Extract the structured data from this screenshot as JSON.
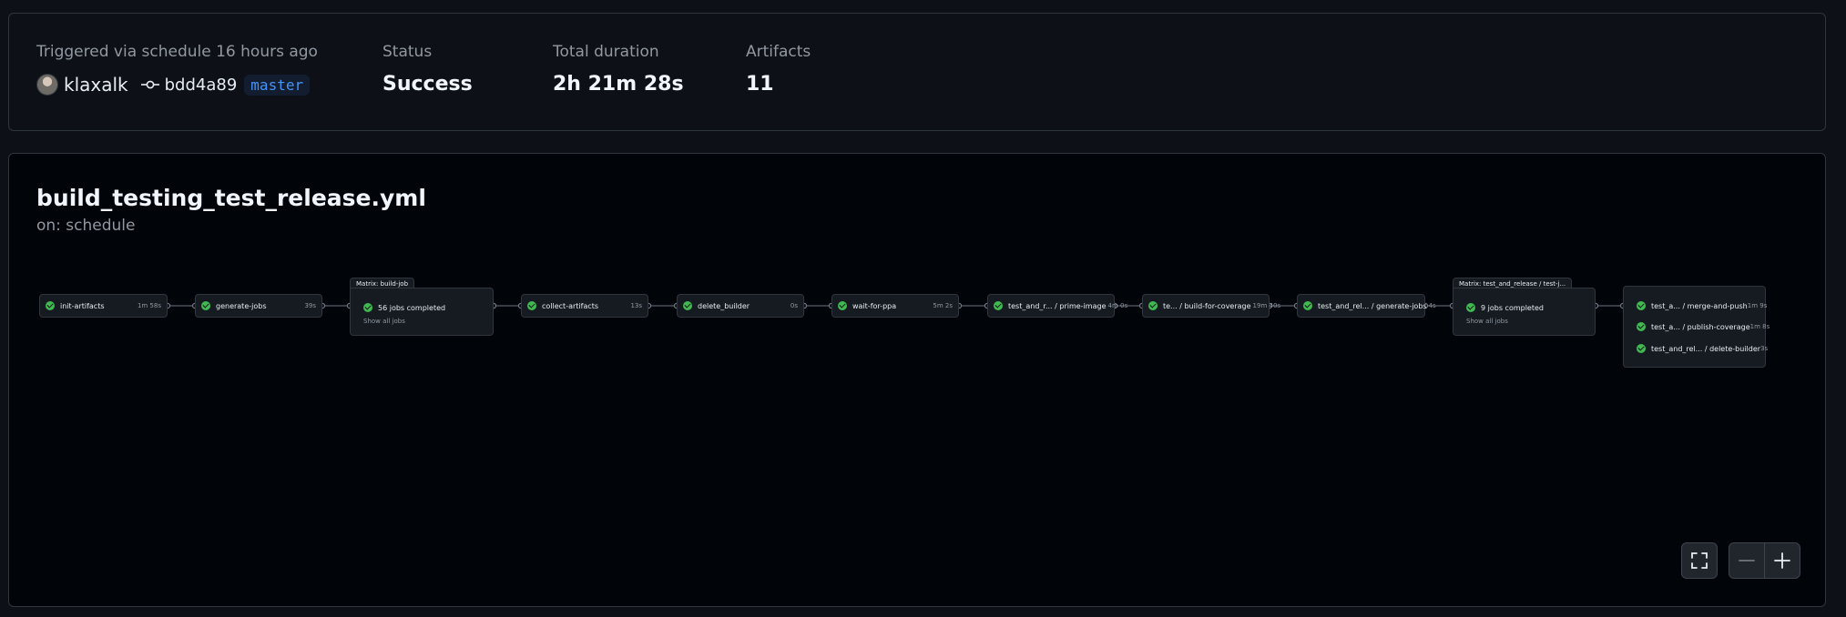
{
  "summary": {
    "trigger_label": "Triggered via schedule 16 hours ago",
    "actor": "klaxalk",
    "commit_sha": "bdd4a89",
    "branch": "master",
    "status_label": "Status",
    "status_value": "Success",
    "duration_label": "Total duration",
    "duration_value": "2h 21m 28s",
    "artifacts_label": "Artifacts",
    "artifacts_value": "11"
  },
  "workflow": {
    "filename": "build_testing_test_release.yml",
    "trigger": "on: schedule"
  },
  "jobs": [
    {
      "name": "init-artifacts",
      "duration": "1m 58s"
    },
    {
      "name": "generate-jobs",
      "duration": "39s"
    },
    {
      "name": "collect-artifacts",
      "duration": "13s"
    },
    {
      "name": "delete_builder",
      "duration": "0s"
    },
    {
      "name": "wait-for-ppa",
      "duration": "5m 2s"
    },
    {
      "name": "test_and_r... / prime-image",
      "duration": "4m 0s"
    },
    {
      "name": "te... / build-for-coverage",
      "duration": "19m 40s"
    },
    {
      "name": "test_and_rel... / generate-jobs",
      "duration": "4s"
    }
  ],
  "matrix_build": {
    "tab": "Matrix: build-job",
    "summary": "56 jobs completed",
    "show_all": "Show all jobs"
  },
  "matrix_test": {
    "tab": "Matrix: test_and_release / test-j...",
    "summary": "9 jobs completed",
    "show_all": "Show all jobs"
  },
  "final_group": [
    {
      "name": "test_a... / merge-and-push",
      "duration": "1m 9s"
    },
    {
      "name": "test_a... / publish-coverage",
      "duration": "1m 8s"
    },
    {
      "name": "test_and_rel... / delete-builder",
      "duration": "3s"
    }
  ],
  "colors": {
    "success": "#3fb950",
    "branch_text": "#4493f8",
    "panel_bg": "#010409",
    "page_bg": "#0d1117"
  },
  "icons": [
    "commit-icon",
    "success-check-icon",
    "fullscreen-icon",
    "zoom-out-icon",
    "zoom-in-icon"
  ]
}
